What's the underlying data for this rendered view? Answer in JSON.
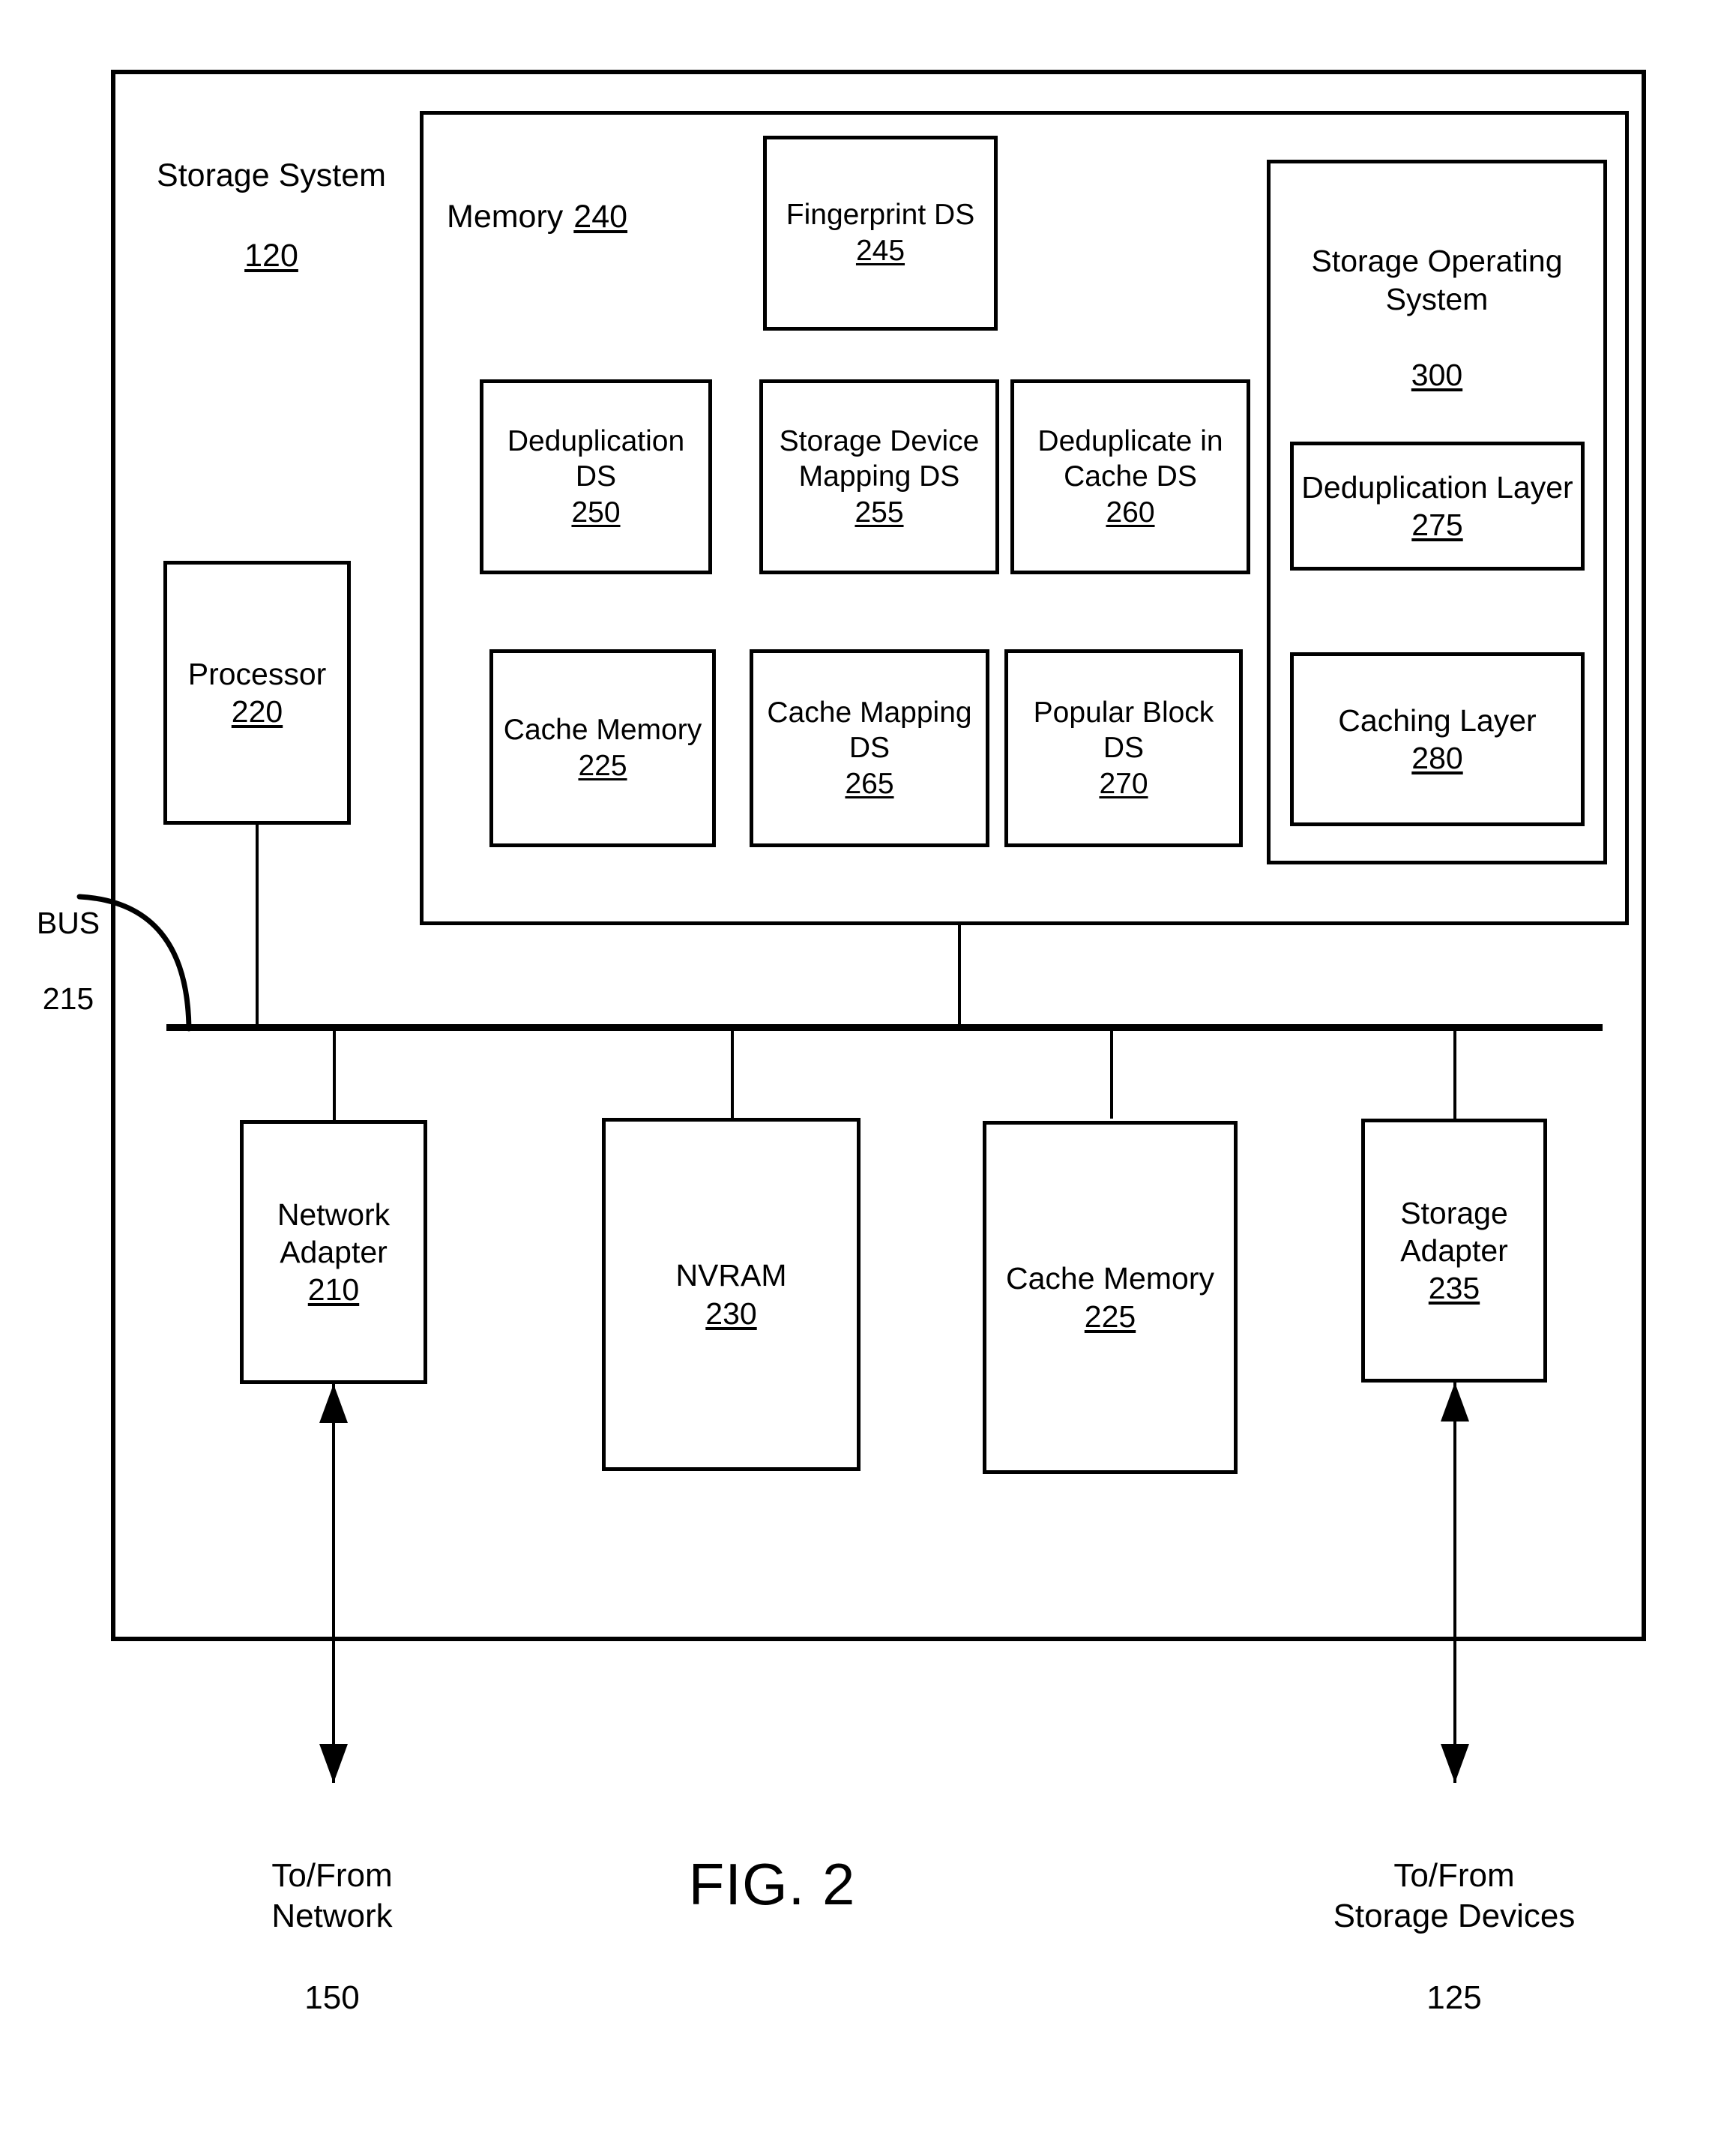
{
  "figure": {
    "caption": "FIG. 2"
  },
  "outer": {
    "title": "Storage System",
    "number": "120"
  },
  "memory": {
    "title": "Memory",
    "number": "240",
    "data_structures": [
      {
        "label": "Fingerprint DS",
        "number": "245"
      },
      {
        "label": "Deduplication\nDS",
        "number": "250"
      },
      {
        "label": "Storage Device\nMapping DS",
        "number": "255"
      },
      {
        "label": "Deduplicate in\nCache DS",
        "number": "260"
      },
      {
        "label": "Cache Memory",
        "number": "225"
      },
      {
        "label": "Cache Mapping\nDS",
        "number": "265"
      },
      {
        "label": "Popular Block\nDS",
        "number": "270"
      }
    ],
    "operating_system": {
      "label": "Storage Operating\nSystem",
      "number": "300",
      "layers": [
        {
          "label": "Deduplication Layer",
          "number": "275"
        },
        {
          "label": "Caching Layer",
          "number": "280"
        }
      ]
    }
  },
  "processor": {
    "label": "Processor",
    "number": "220"
  },
  "bus": {
    "label": "BUS",
    "number": "215"
  },
  "adapters": [
    {
      "label": "Network\nAdapter",
      "number": "210"
    },
    {
      "label": "NVRAM",
      "number": "230"
    },
    {
      "label": "Cache Memory",
      "number": "225"
    },
    {
      "label": "Storage\nAdapter",
      "number": "235"
    }
  ],
  "io_labels": [
    {
      "label": "To/From\nNetwork",
      "number": "150"
    },
    {
      "label": "To/From\nStorage Devices",
      "number": "125"
    }
  ],
  "colors": {
    "ink": "#000000",
    "paper": "#ffffff"
  }
}
